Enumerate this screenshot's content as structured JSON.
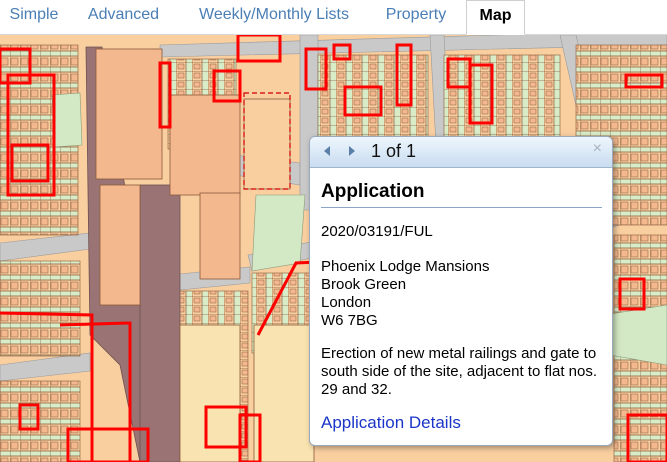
{
  "tabs": [
    {
      "label": "Simple"
    },
    {
      "label": "Advanced"
    },
    {
      "label": "Weekly/Monthly Lists"
    },
    {
      "label": "Property"
    },
    {
      "label": "Map",
      "active": true
    }
  ],
  "popup": {
    "pager": "1 of 1",
    "close_icon": "×",
    "title": "Application",
    "reference": "2020/03191/FUL",
    "address": [
      "Phoenix Lodge Mansions",
      "Brook Green",
      "London",
      "W6 7BG"
    ],
    "description": "Erection of new metal railings and gate to south side of the site, adjacent to flat nos. 29 and 32.",
    "link": "Application Details"
  },
  "colors": {
    "tab_text": "#4a7eb5",
    "map_land": "#f9cfa0",
    "map_green": "#d3e8c4",
    "map_road": "#c9c9c9",
    "map_rail": "#9a7474",
    "map_boundary": "#ff0000",
    "map_building": "#f3b88e",
    "link": "#1a35c8"
  }
}
